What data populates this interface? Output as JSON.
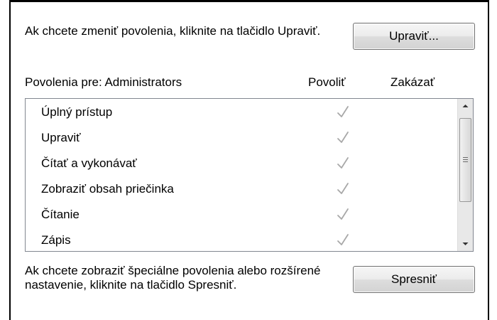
{
  "edit_section": {
    "instruction": "Ak chcete zmeniť povolenia, kliknite na tlačidlo Upraviť.",
    "edit_button": "Upraviť..."
  },
  "permissions": {
    "header_label": "Povolenia pre: Administrators",
    "col_allow": "Povoliť",
    "col_deny": "Zakázať",
    "rows": [
      {
        "name": "Úplný prístup",
        "allow": true,
        "deny": false
      },
      {
        "name": "Upraviť",
        "allow": true,
        "deny": false
      },
      {
        "name": "Čítať a vykonávať",
        "allow": true,
        "deny": false
      },
      {
        "name": "Zobraziť obsah priečinka",
        "allow": true,
        "deny": false
      },
      {
        "name": "Čítanie",
        "allow": true,
        "deny": false
      },
      {
        "name": "Zápis",
        "allow": true,
        "deny": false
      }
    ]
  },
  "advanced_section": {
    "instruction": "Ak chcete zobraziť špeciálne povolenia alebo rozšírené nastavenie, kliknite na tlačidlo Spresniť.",
    "advanced_button": "Spresniť"
  },
  "icons": {
    "check": "checkmark-icon",
    "scroll_up": "scroll-up-arrow-icon",
    "scroll_down": "scroll-down-arrow-icon"
  },
  "colors": {
    "check": "#a8a8a8",
    "listbox_border": "#828790",
    "button_border": "#707070"
  }
}
